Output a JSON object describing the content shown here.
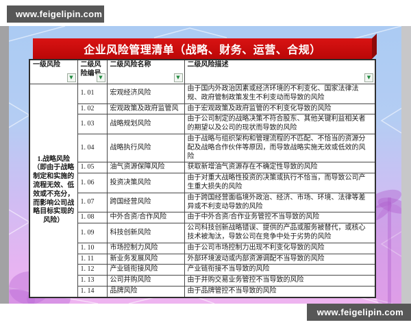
{
  "watermarks": {
    "top_left": "www.feigelipin.com",
    "bottom_right": "www.feigelipin.com"
  },
  "title": "企业风险管理清单（战略、财务、运营、合规）",
  "icons": {
    "filter_arrow": "▼"
  },
  "colors": {
    "title_bar_red": "#cf0c0c",
    "title_bar_side_red": "#8e0909",
    "filter_arrow_green": "#1f8a3d",
    "table_border": "#474747",
    "background_top_blue": "#abcbf3",
    "background_bottom_pink": "#eeb4f0"
  },
  "table": {
    "headers": [
      {
        "label": "一级风险"
      },
      {
        "label": "二级风险编号"
      },
      {
        "label": "二级风险名称"
      },
      {
        "label": "二级风险描述"
      }
    ],
    "level1_risk": "1.战略风险（即由于战略制定和实施的流程无效、低效或不充分，而影响公司战略目标实现的风险）",
    "rows": [
      {
        "id": "1. 01",
        "name": "宏观经济风险",
        "desc": "由于国内外政治因素或经济环境的不利变化、国家法律法规、政府管制政策发生不利变动而导致的风险"
      },
      {
        "id": "1. 02",
        "name": "宏观政策及政府监管风",
        "desc": "由于宏观政策及政府监管的不利变化导致的风险"
      },
      {
        "id": "1. 03",
        "name": "战略规划风险",
        "desc": "由于公司制定的战略决策不符合股东、其他关键利益相关者的期望以及公司的现状而导致的风险"
      },
      {
        "id": "1. 04",
        "name": "战略执行风险",
        "desc": "由于战略与组织架构和管理流程的不匹配、不恰当的资源分配及战略合作伙伴等原因，而导致战略实施无效或低效的风险"
      },
      {
        "id": "1. 05",
        "name": "油气资源保障风险",
        "desc": "获取新增油气资源存在不确定性导致的风险"
      },
      {
        "id": "1. 06",
        "name": "投资决策风险",
        "desc": "由于对重大战略性投资的决策或执行不恰当，而导致公司产生重大损失的风险"
      },
      {
        "id": "1. 07",
        "name": "跨国经营风险",
        "desc": "由于跨国经营面临境外政治、经济、市场、环境、法律等差异或不利变动导致的风险"
      },
      {
        "id": "1. 08",
        "name": "中外合资/合作风险",
        "desc": "由于中外合资/合作业务管控不当导致的风险"
      },
      {
        "id": "1. 09",
        "name": "科技创新风险",
        "desc": "公司科技创新战略错误、提供的产品或服务被替代，或核心技术被淘汰，导致公司在竞争中处于劣势的风险"
      },
      {
        "id": "1. 10",
        "name": "市场控制力风险",
        "desc": "由于公司市场控制力出现不利变化导致的风险"
      },
      {
        "id": "1. 11",
        "name": "新业务发展风险",
        "desc": "外部环境波动或内部资源调配不当导致的风险"
      },
      {
        "id": "1. 12",
        "name": "产业链衔接风险",
        "desc": "产业链衔接不当导致的风险"
      },
      {
        "id": "1. 13",
        "name": "公司并购风险",
        "desc": "由于并购交易业务管控不当导致的风险"
      },
      {
        "id": "1. 14",
        "name": "品牌风险",
        "desc": "由于品牌管控不当导致的风险"
      }
    ]
  }
}
